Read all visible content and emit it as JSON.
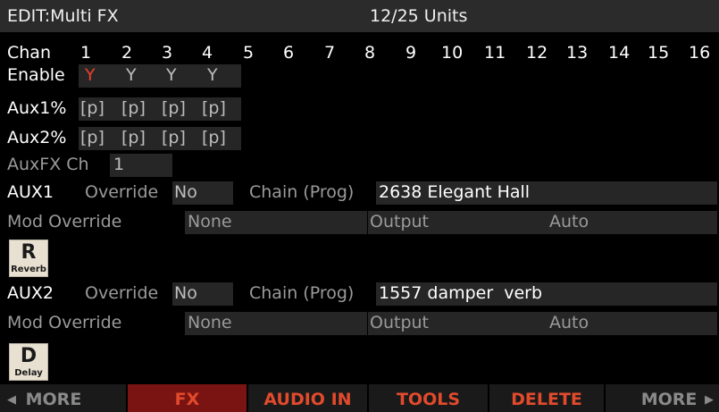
{
  "title": {
    "left": "EDIT:Multi FX",
    "units": "12/25 Units"
  },
  "chan": {
    "label": "Chan",
    "numbers": [
      "1",
      "2",
      "3",
      "4",
      "5",
      "6",
      "7",
      "8",
      "9",
      "10",
      "11",
      "12",
      "13",
      "14",
      "15",
      "16"
    ]
  },
  "enable": {
    "label": "Enable",
    "values": [
      "Y",
      "Y",
      "Y",
      "Y"
    ]
  },
  "aux1pct": {
    "label": "Aux1%",
    "values": [
      "[p]",
      "[p]",
      "[p]",
      "[p]"
    ]
  },
  "aux2pct": {
    "label": "Aux2%",
    "values": [
      "[p]",
      "[p]",
      "[p]",
      "[p]"
    ]
  },
  "auxfx": {
    "label": "AuxFX Ch",
    "value": "1"
  },
  "aux1": {
    "label": "AUX1",
    "override_label": "Override",
    "override_value": "No",
    "chain_label": "Chain (Prog)",
    "chain_value": "2638 Elegant Hall",
    "mod_label": "Mod Override",
    "mod_value": "None",
    "output_label": "Output",
    "output_value": "Auto",
    "icon_letter": "R",
    "icon_text": "Reverb"
  },
  "aux2": {
    "label": "AUX2",
    "override_label": "Override",
    "override_value": "No",
    "chain_label": "Chain (Prog)",
    "chain_value": "1557 damper  verb",
    "mod_label": "Mod Override",
    "mod_value": "None",
    "output_label": "Output",
    "output_value": "Auto",
    "icon_letter": "D",
    "icon_text": "Delay"
  },
  "softkeys": [
    "MORE",
    "FX",
    "AUDIO IN",
    "TOOLS",
    "DELETE",
    "MORE"
  ],
  "arrows": {
    "left": "◀",
    "right": "▶"
  },
  "colors": {
    "active_tab": "#7a1412",
    "softkey_text": "#e24a2c",
    "inactive_softkey_text": "#8a8a8a",
    "enable_first": "#e8402a"
  }
}
